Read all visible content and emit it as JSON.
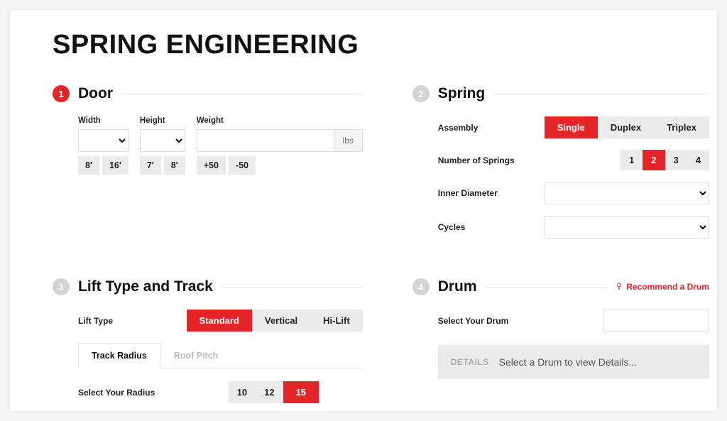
{
  "page_title": "SPRING ENGINEERING",
  "sections": {
    "door": {
      "step": "1",
      "title": "Door",
      "width_label": "Width",
      "height_label": "Height",
      "weight_label": "Weight",
      "weight_unit": "lbs",
      "width_quick": [
        "8'",
        "16'"
      ],
      "height_quick": [
        "7'",
        "8'"
      ],
      "weight_quick": [
        "+50",
        "-50"
      ]
    },
    "spring": {
      "step": "2",
      "title": "Spring",
      "assembly_label": "Assembly",
      "assembly_options": [
        "Single",
        "Duplex",
        "Triplex"
      ],
      "assembly_selected": "Single",
      "num_springs_label": "Number of Springs",
      "num_springs_options": [
        "1",
        "2",
        "3",
        "4"
      ],
      "num_springs_selected": "2",
      "inner_diameter_label": "Inner Diameter",
      "cycles_label": "Cycles"
    },
    "lift": {
      "step": "3",
      "title": "Lift Type and Track",
      "lift_type_label": "Lift Type",
      "lift_type_options": [
        "Standard",
        "Vertical",
        "Hi-Lift"
      ],
      "lift_type_selected": "Standard",
      "tabs": [
        "Track Radius",
        "Roof Pitch"
      ],
      "tab_selected": "Track Radius",
      "radius_label": "Select Your Radius",
      "radius_options": [
        "10",
        "12",
        "15"
      ],
      "radius_selected": "15"
    },
    "drum": {
      "step": "4",
      "title": "Drum",
      "recommend_label": "Recommend a Drum",
      "select_label": "Select Your Drum",
      "details_label": "DETAILS",
      "details_text": "Select a Drum to view Details..."
    }
  }
}
